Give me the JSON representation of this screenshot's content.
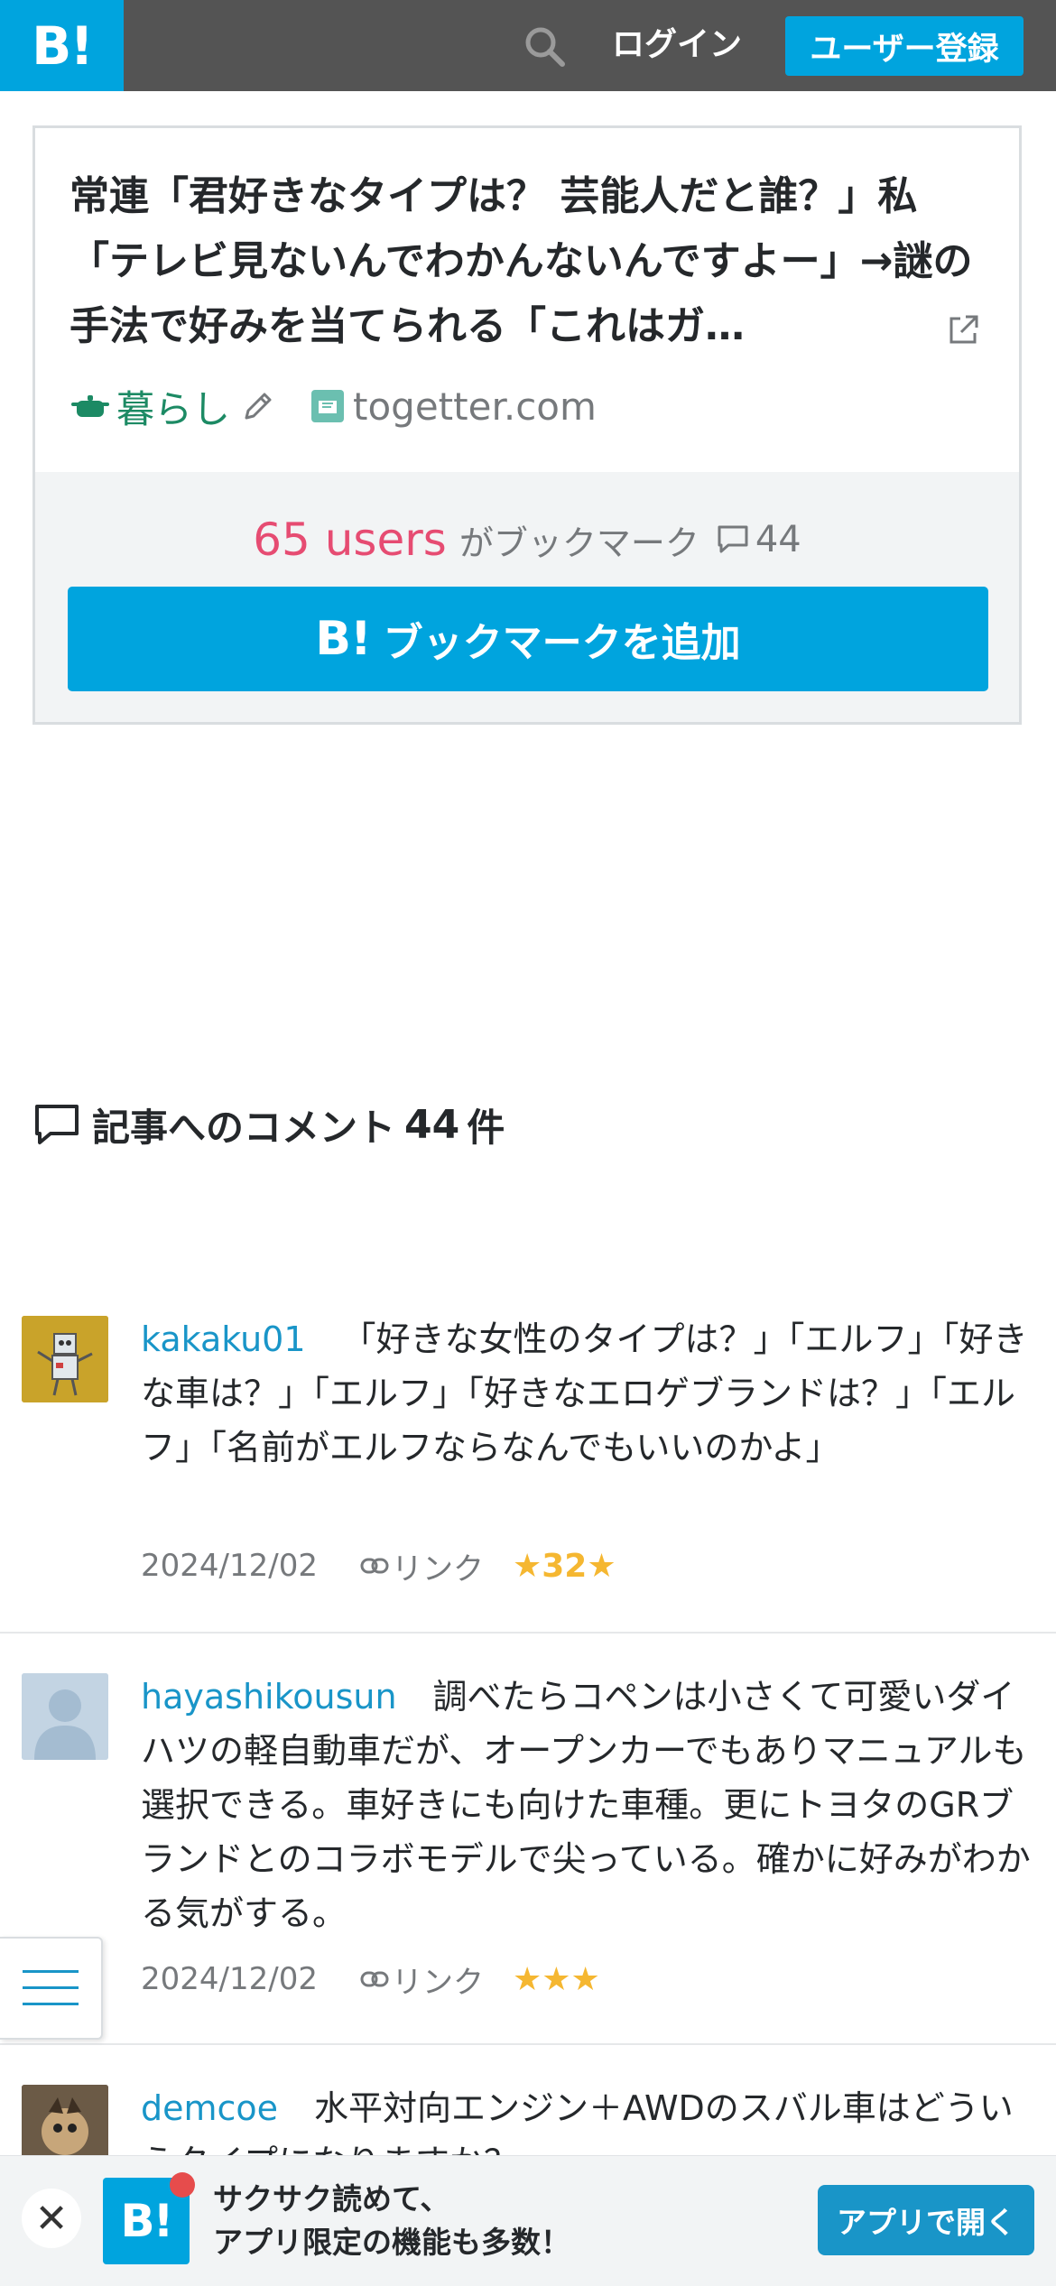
{
  "header": {
    "logo_text": "B!",
    "login_label": "ログイン",
    "register_label": "ユーザー登録"
  },
  "entry": {
    "title": "常連「君好きなタイプは？ 芸能人だと誰？」私「テレビ見ないんでわかんないんですよー」→謎の手法で好みを当てられる「これはガ…",
    "category": "暮らし",
    "domain": "togetter.com",
    "users_count": "65 users",
    "users_suffix": "がブックマーク",
    "comment_count": "44",
    "add_bookmark_label": "ブックマークを追加",
    "add_bookmark_logo": "B!"
  },
  "comments_section": {
    "heading": "記事へのコメント",
    "count": "44",
    "unit": "件"
  },
  "comments": [
    {
      "user": "kakaku01",
      "text": "「好きな女性のタイプは？」「エルフ」「好きな車は？」「エルフ」「好きなエロゲブランドは？」「エルフ」「名前がエルフならなんでもいいのかよ」",
      "date": "2024/12/02",
      "link_label": "リンク",
      "stars": "★32★"
    },
    {
      "user": "hayashikousun",
      "text": "調べたらコペンは小さくて可愛いダイハツの軽自動車だが、オープンカーでもありマニュアルも選択できる。車好きにも向けた車種。更にトヨタのGRブランドとのコラボモデルで尖っている。確かに好みがわかる気がする。",
      "date": "2024/12/02",
      "link_label": "リンク",
      "stars": "★★★"
    },
    {
      "user": "demcoe",
      "text": "水平対向エンジン＋AWDのスバル車はどういうタイプになりますか？"
    }
  ],
  "app_banner": {
    "close_glyph": "✕",
    "logo_text": "B!",
    "line1": "サクサク読めて、",
    "line2": "アプリ限定の機能も多数！",
    "open_label": "アプリで開く"
  },
  "colors": {
    "brand": "#00a4de",
    "header_bg": "#545454",
    "users": "#e64c72",
    "username": "#1995c8",
    "stars": "#f5b731",
    "category": "#1c8a64"
  }
}
